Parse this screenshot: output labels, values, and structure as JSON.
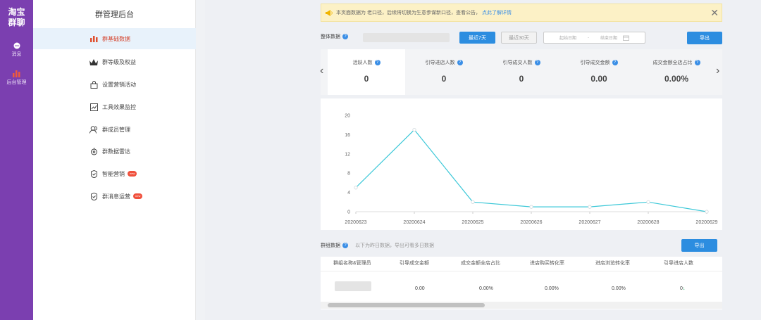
{
  "rail": {
    "logo_line1": "淘宝",
    "logo_line2": "群聊",
    "items": [
      {
        "label": "消息",
        "icon": "chat-icon"
      },
      {
        "label": "后台管理",
        "icon": "bar-chart-icon"
      }
    ],
    "bg_color": "#7b3fb0"
  },
  "sidebar": {
    "title": "群管理后台",
    "items": [
      {
        "label": "群基础数据",
        "icon": "bar-chart-icon",
        "active": true
      },
      {
        "label": "群等级及权益",
        "icon": "crown-icon"
      },
      {
        "label": "设置营销活动",
        "icon": "shopping-bag-icon"
      },
      {
        "label": "工具效果监控",
        "icon": "monitor-icon"
      },
      {
        "label": "群成员管理",
        "icon": "user-icon"
      },
      {
        "label": "群数据雷达",
        "icon": "radar-icon"
      },
      {
        "label": "智能营销",
        "icon": "shield-check-icon",
        "badge": "new"
      },
      {
        "label": "群消息运营",
        "icon": "shield-check-icon",
        "badge": "new"
      }
    ]
  },
  "notice": {
    "text": "本页面数据为 老口径，后续将切换为生意参谋新口径，查看公告，",
    "link": "点此了解详情",
    "close": "✕"
  },
  "overview": {
    "label": "整体数据",
    "btn_7days": "最近7天",
    "btn_30days": "最近30天",
    "start_placeholder": "起始日期",
    "separator": "-",
    "end_placeholder": "结束日期",
    "export": "导出"
  },
  "metrics": [
    {
      "label": "活跃人数",
      "value": "0"
    },
    {
      "label": "引导进店人数",
      "value": "0"
    },
    {
      "label": "引导成交人数",
      "value": "0"
    },
    {
      "label": "引导成交金额",
      "value": "0.00"
    },
    {
      "label": "成交金额全店占比",
      "value": "0.00%"
    }
  ],
  "chart_data": {
    "type": "line",
    "x": [
      "20200623",
      "20200624",
      "20200625",
      "20200626",
      "20200627",
      "20200628",
      "20200629"
    ],
    "series": [
      {
        "values": [
          5,
          17,
          2,
          1,
          1,
          2,
          0
        ]
      }
    ],
    "ylim": [
      0,
      20
    ],
    "yticks": [
      0,
      4,
      8,
      12,
      16,
      20
    ],
    "grid": false,
    "color": "#3cc8d8"
  },
  "group_data": {
    "label": "群组数据",
    "hint": "以下为昨日数据，导出可看多日数据",
    "export": "导出",
    "columns": [
      "群组名称&管理员",
      "引导成交金额",
      "成交金额全店占比",
      "进店购买转化率",
      "进店浏览转化率",
      "引导进店人数"
    ],
    "rows": [
      [
        "",
        "0.00",
        "0.00%",
        "0.00%",
        "0.00%",
        "0"
      ]
    ]
  }
}
